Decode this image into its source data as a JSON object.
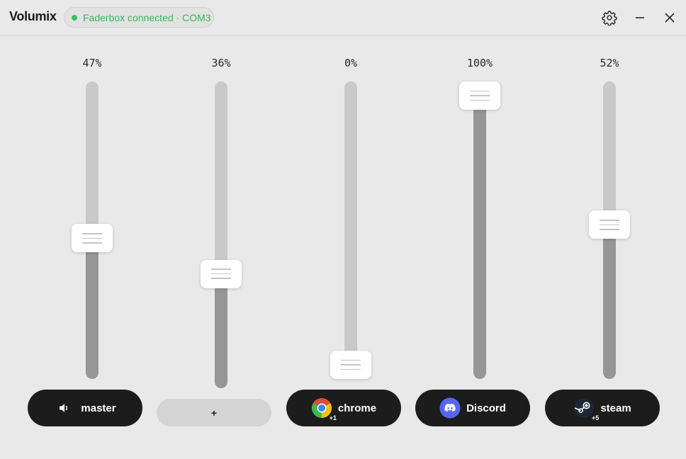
{
  "app": {
    "title": "Volumix"
  },
  "status": {
    "text": "Faderbox connected · COM3",
    "color": "#35b95a"
  },
  "window": {
    "settings_icon": "gear-icon",
    "minimize_icon": "minimize-icon",
    "close_icon": "close-icon"
  },
  "colors": {
    "chip_bg": "#1c1c1c",
    "track": "#c9c9c9",
    "track_fill": "#969696",
    "background": "#e9e9e9"
  },
  "channels": [
    {
      "percent_label": "47%",
      "level": 0.47,
      "label": "master",
      "icon": "speaker-icon",
      "badge": ""
    },
    {
      "percent_label": "36%",
      "level": 0.36,
      "label": "+",
      "icon": "",
      "badge": ""
    },
    {
      "percent_label": "0%",
      "level": 0.0,
      "label": "chrome",
      "icon": "chrome-icon",
      "badge": "+1"
    },
    {
      "percent_label": "100%",
      "level": 1.0,
      "label": "Discord",
      "icon": "discord-icon",
      "badge": ""
    },
    {
      "percent_label": "52%",
      "level": 0.52,
      "label": "steam",
      "icon": "steam-icon",
      "badge": "+5"
    }
  ]
}
